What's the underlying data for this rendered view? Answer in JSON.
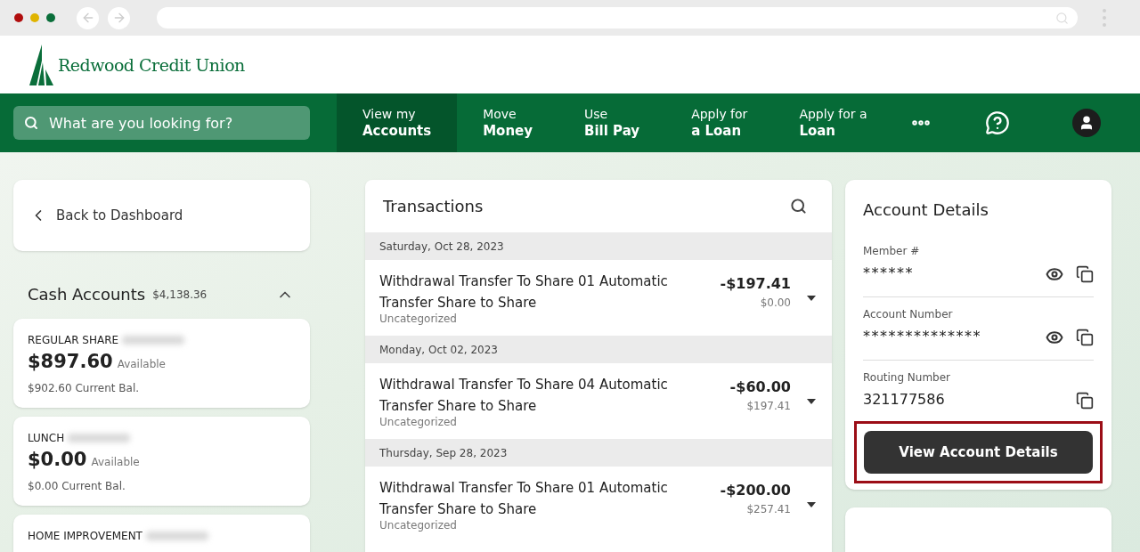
{
  "browser": {
    "window_controls": [
      {
        "color": "#b00d0d"
      },
      {
        "color": "#e0b400"
      },
      {
        "color": "#0a6e3a"
      }
    ]
  },
  "header": {
    "brand": "Redwood Credit Union"
  },
  "nav": {
    "search": {
      "placeholder": "What are you looking for?"
    },
    "items": [
      {
        "line1": "View my",
        "line2": "Accounts",
        "selected": true
      },
      {
        "line1": "Move",
        "line2": "Money",
        "selected": false
      },
      {
        "line1": "Use",
        "line2": "Bill Pay",
        "selected": false
      },
      {
        "line1": "Apply for",
        "line2": "a Loan",
        "selected": false
      },
      {
        "line1": "Apply for a",
        "line2": "Loan",
        "selected": false
      }
    ]
  },
  "sidebar": {
    "back": "Back to Dashboard",
    "section": {
      "title": "Cash Accounts",
      "total": "$4,138.36",
      "expanded": true
    },
    "accounts": [
      {
        "name": "REGULAR SHARE",
        "available": "$897.60",
        "available_label": "Available",
        "current": "$902.60 Current Bal."
      },
      {
        "name": "LUNCH",
        "available": "$0.00",
        "available_label": "Available",
        "current": "$0.00 Current Bal."
      },
      {
        "name": "HOME IMPROVEMENT"
      }
    ]
  },
  "transactions": {
    "title": "Transactions",
    "groups": [
      {
        "date": "Saturday, Oct 28, 2023",
        "rows": [
          {
            "description": "Withdrawal Transfer To Share 01 Automatic Transfer Share to Share",
            "category": "Uncategorized",
            "amount": "-$197.41",
            "balance": "$0.00"
          }
        ]
      },
      {
        "date": "Monday, Oct 02, 2023",
        "rows": [
          {
            "description": "Withdrawal Transfer To Share 04 Automatic Transfer Share to Share",
            "category": "Uncategorized",
            "amount": "-$60.00",
            "balance": "$197.41"
          }
        ]
      },
      {
        "date": "Thursday, Sep 28, 2023",
        "rows": [
          {
            "description": "Withdrawal Transfer To Share 01 Automatic Transfer Share to Share",
            "category": "Uncategorized",
            "amount": "-$200.00",
            "balance": "$257.41"
          }
        ]
      }
    ]
  },
  "account_details": {
    "title": "Account Details",
    "fields": [
      {
        "label": "Member #",
        "value": "******",
        "revealable": true
      },
      {
        "label": "Account Number",
        "value": "**************",
        "revealable": true
      },
      {
        "label": "Routing Number",
        "value": "321177586",
        "revealable": false
      }
    ],
    "button": {
      "label": "View Account Details",
      "highlighted": true
    }
  }
}
